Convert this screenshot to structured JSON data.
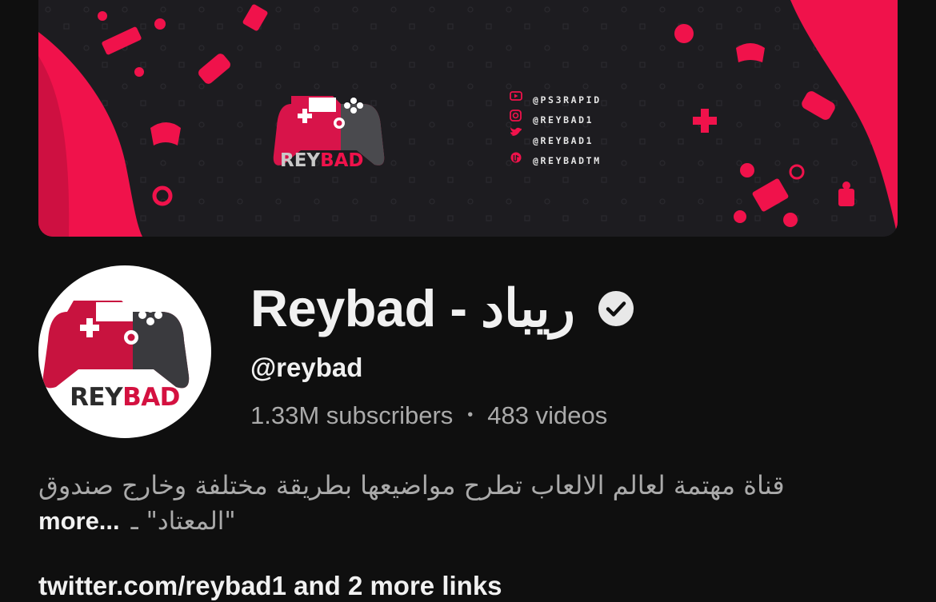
{
  "banner": {
    "logo_text_primary": "REY",
    "logo_text_accent": "BAD",
    "social_handles": [
      {
        "icon": "youtube-icon",
        "text": "@PS3RAPID"
      },
      {
        "icon": "instagram-icon",
        "text": "@REYBAD1"
      },
      {
        "icon": "twitter-icon",
        "text": "@REYBAD1"
      },
      {
        "icon": "tiktok-icon",
        "text": "@REYBADTM"
      }
    ]
  },
  "avatar": {
    "text_primary": "REY",
    "text_accent": "BAD"
  },
  "channel": {
    "title": "Reybad - ريباد",
    "verified_icon": "verified-check-icon",
    "handle": "@reybad",
    "subscribers": "1.33M subscribers",
    "separator": "•",
    "videos": "483 videos",
    "description_line1": "قناة مهتمة لعالم الالعاب تطرح مواضيعها بطريقة مختلفة وخارج صندوق",
    "description_line2": "\"المعتاد\" ـ",
    "more_label": "more...",
    "links_text": "twitter.com/reybad1 and 2 more links"
  },
  "colors": {
    "background": "#0f0f0f",
    "brand_red": "#f0124b",
    "text_primary": "#f1f1f1",
    "text_secondary": "#aaaaaa"
  }
}
